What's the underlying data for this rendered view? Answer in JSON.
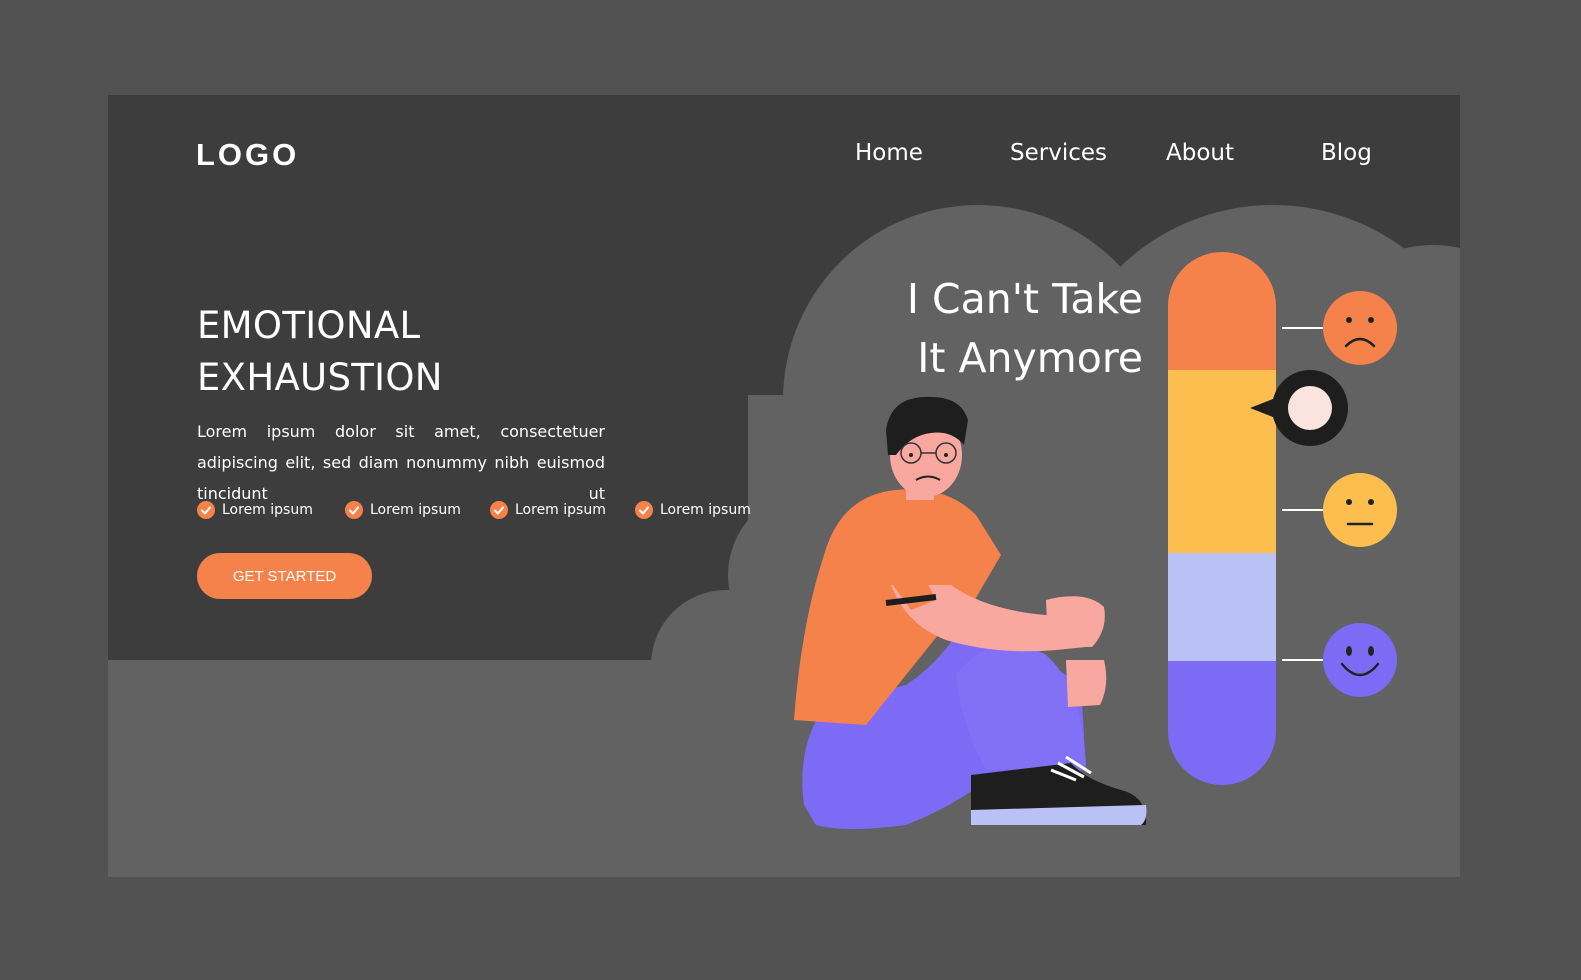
{
  "header": {
    "logo": "LOGO",
    "nav": [
      {
        "label": "Home"
      },
      {
        "label": "Services"
      },
      {
        "label": "About"
      },
      {
        "label": "Blog"
      }
    ]
  },
  "hero": {
    "title_line1": "EMOTIONAL",
    "title_line2": "EXHAUSTION",
    "description": "Lorem ipsum dolor sit amet, consectetuer adipiscing elit, sed diam nonummy nibh euismod tincidunt ut",
    "checklist": [
      "Lorem ipsum",
      "Lorem ipsum",
      "Lorem ipsum",
      "Lorem ipsum"
    ],
    "cta_label": "GET STARTED"
  },
  "illustration": {
    "quote_line1": "I Can't Take",
    "quote_line2": "It Anymore",
    "mood_scale": [
      "sad-face-icon",
      "current-level-marker",
      "neutral-face-icon",
      "happy-face-icon"
    ]
  },
  "colors": {
    "page_bg": "#525252",
    "frame_bg": "#3d3d3d",
    "cloud": "#626262",
    "accent_orange": "#f5824a",
    "yellow": "#fcbf4f",
    "lavender": "#b9c1f5",
    "purple": "#7d6bf5"
  }
}
